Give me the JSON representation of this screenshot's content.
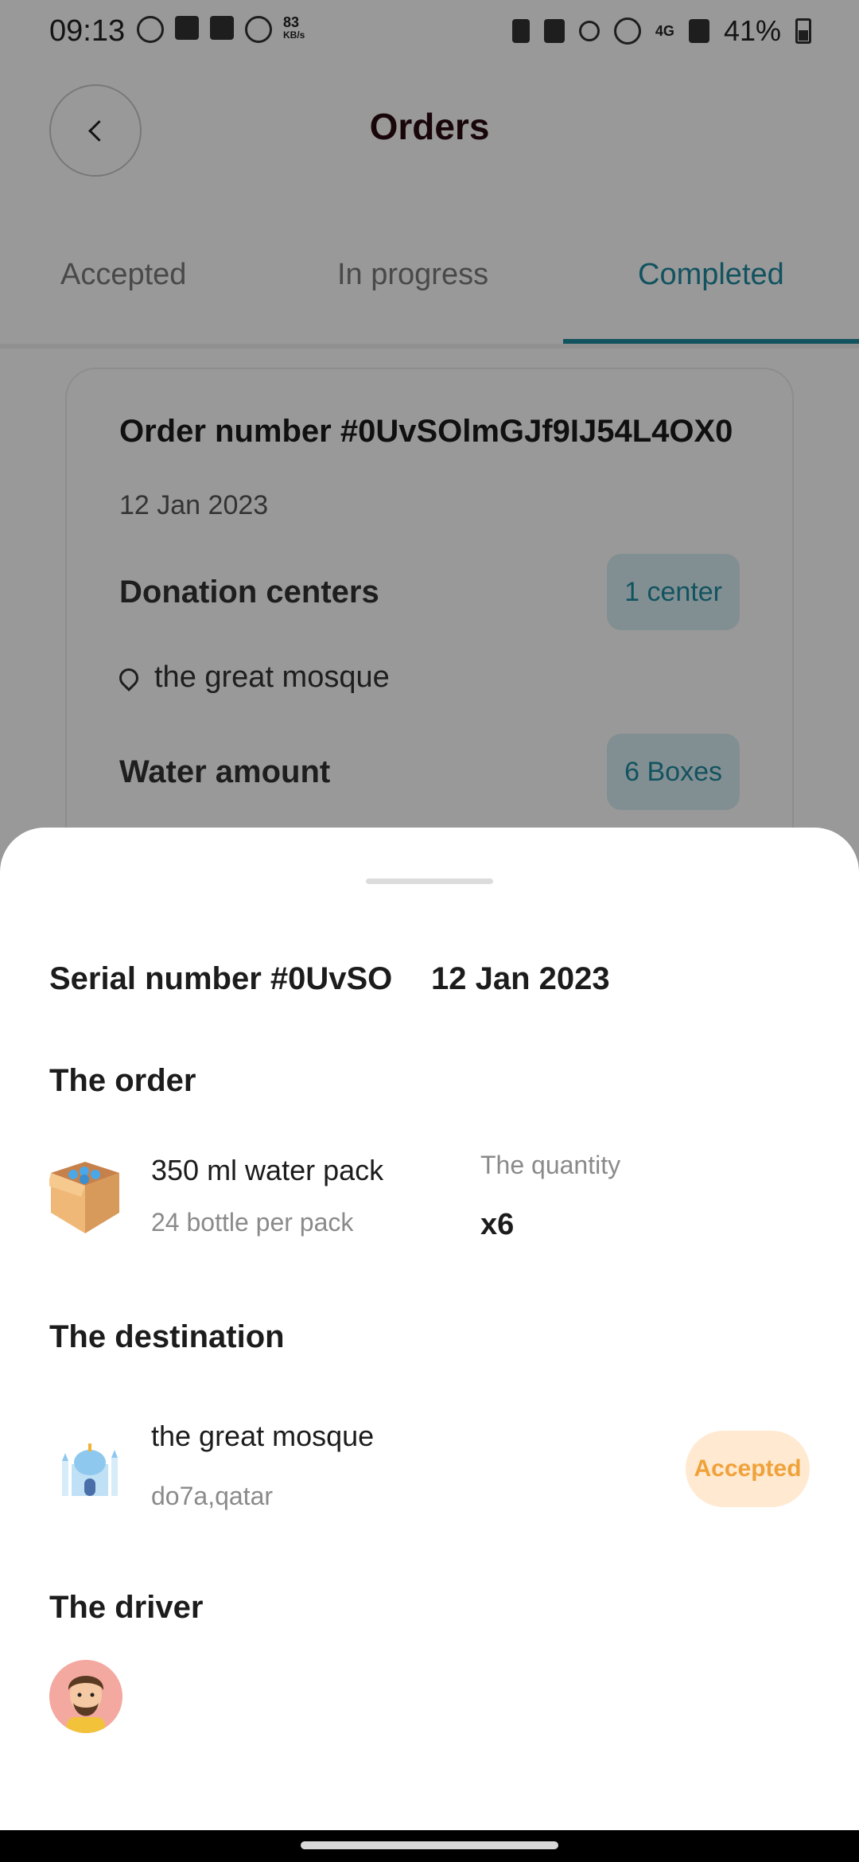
{
  "status_bar": {
    "time": "09:13",
    "net_speed": "83",
    "net_unit": "KB/s",
    "network": "4G",
    "battery": "41%"
  },
  "header": {
    "title": "Orders",
    "back_icon": "chevron-left-icon"
  },
  "tabs": [
    {
      "label": "Accepted",
      "active": false
    },
    {
      "label": "In progress",
      "active": false
    },
    {
      "label": "Completed",
      "active": true
    }
  ],
  "order_card": {
    "order_number": "Order number #0UvSOlmGJf9IJ54L4OX0",
    "date": "12 Jan 2023",
    "centers_label": "Donation centers",
    "centers_value": "1 center",
    "location": "the great mosque",
    "water_label": "Water amount",
    "water_value": "6 Boxes"
  },
  "sheet": {
    "serial": "Serial number #0UvSO",
    "date": "12 Jan 2023",
    "order_title": "The order",
    "item_name": "350 ml water pack",
    "item_desc": "24 bottle per pack",
    "qty_label": "The quantity",
    "qty_value": "x6",
    "destination_title": "The destination",
    "destination_name": "the great mosque",
    "destination_address": "do7a,qatar",
    "destination_status": "Accepted",
    "driver_title": "The driver"
  },
  "colors": {
    "accent": "#1f8aa0",
    "badge_bg": "#ffe9d1",
    "badge_text": "#f0a23a",
    "pill_bg": "#d9eef3"
  }
}
